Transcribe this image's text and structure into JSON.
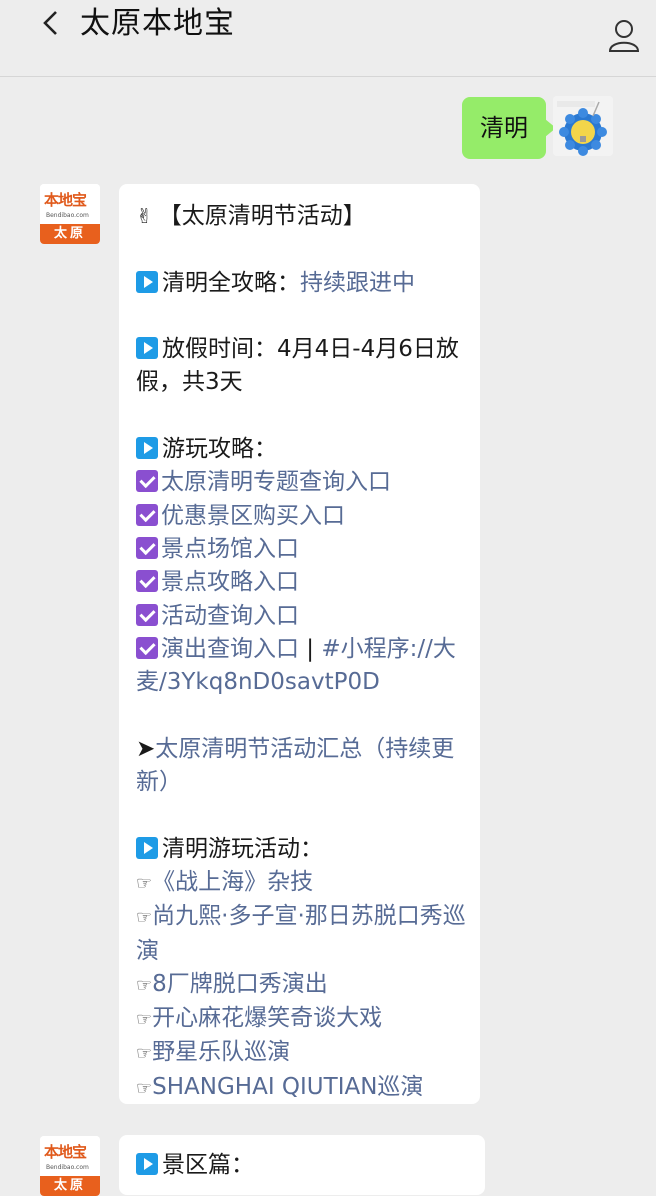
{
  "header": {
    "title": "太原本地宝"
  },
  "outgoing": {
    "text": "清明"
  },
  "incoming_avatar": {
    "logo": "本地宝",
    "logo_sub": "Bendibao.com",
    "city": "太原"
  },
  "message": {
    "heading_emoji": "✌",
    "heading": "【太原清明节活动】",
    "guide_label": "清明全攻略：",
    "guide_link": "持续跟进中",
    "holiday_label": "放假时间：4月4日-4月6日放假，共3天",
    "play_label": "游玩攻略：",
    "checks": [
      "太原清明专题查询入口",
      "优惠景区购买入口",
      "景点场馆入口",
      "景点攻略入口",
      "活动查询入口",
      "演出查询入口"
    ],
    "pipe": " | ",
    "miniprogram_link": "#小程序://大麦/3Ykq8nD0savtP0D",
    "arrow": "➤",
    "summary_link": "太原清明节活动汇总（持续更新）",
    "activities_label": "清明游玩活动：",
    "hand": "☞",
    "activities": [
      "《战上海》杂技",
      "尚九熙·多子宣·那日苏脱口秀巡演",
      "8厂牌脱口秀演出",
      "开心麻花爆笑奇谈大戏",
      "野星乐队巡演",
      "SHANGHAI QIUTIAN巡演"
    ]
  },
  "message2": {
    "label": "景区篇："
  },
  "colors": {
    "background": "#ededed",
    "outgoing_bubble": "#95ec69",
    "link": "#576b95",
    "play_icon": "#1e9be6",
    "check_icon": "#8a4fd0",
    "brand_orange": "#e8601d"
  }
}
